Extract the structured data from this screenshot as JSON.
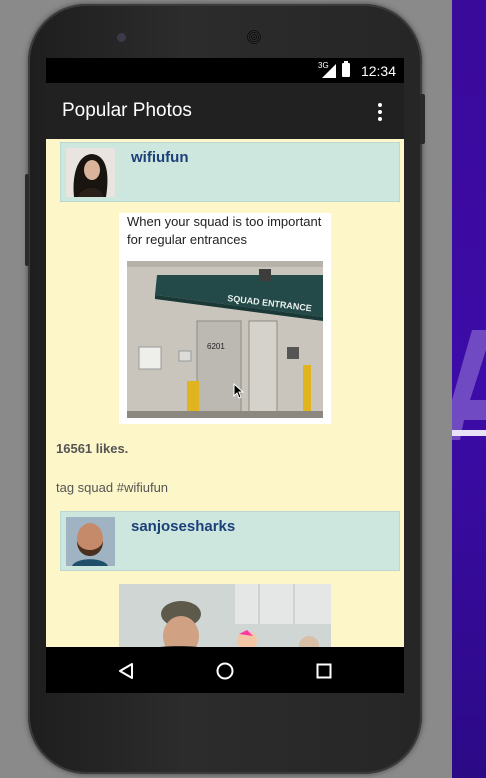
{
  "status_bar": {
    "network": "3G",
    "time": "12:34"
  },
  "app_bar": {
    "title": "Popular Photos"
  },
  "posts": [
    {
      "username": "wifiufun",
      "caption": "When your squad is too important for regular entrances",
      "sign_text": "SQUAD ENTRANCE",
      "door_number": "6201",
      "likes": "16561 likes.",
      "tags": "tag squad #wifiufun"
    },
    {
      "username": "sanjosesharks"
    }
  ],
  "icons": {
    "overflow": "more-vert-icon",
    "back": "back-triangle-icon",
    "home": "home-circle-icon",
    "recents": "recents-square-icon"
  },
  "colors": {
    "app_bar": "#212121",
    "feed_background": "#fdf6c9",
    "user_row": "#cde7df",
    "username": "#1d3f7a"
  }
}
